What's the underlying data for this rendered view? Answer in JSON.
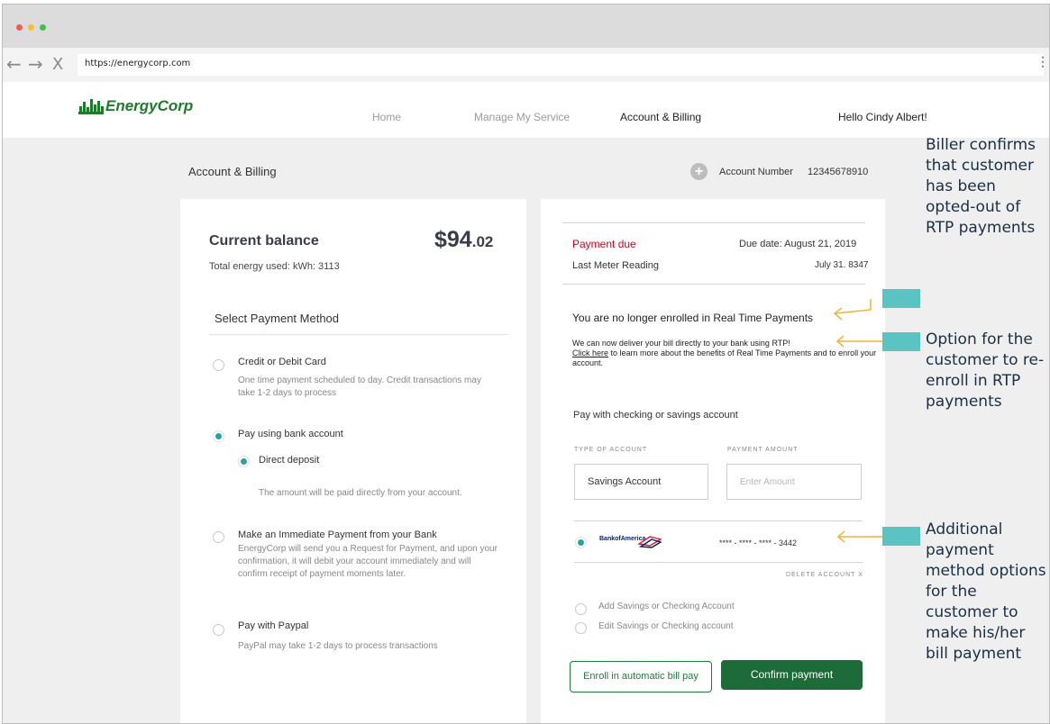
{
  "browser": {
    "url": "https://energycorp.com",
    "back_icon": "←",
    "forward_icon": "→",
    "close_icon": "X",
    "menu_icon": "⋮"
  },
  "header": {
    "logo_text": "EnergyCorp",
    "nav": {
      "home": "Home",
      "manage": "Manage My Service",
      "account": "Account & Billing",
      "greeting": "Hello Cindy Albert!"
    }
  },
  "page": {
    "title": "Account & Billing",
    "add_icon": "+",
    "account_label": "Account Number",
    "account_number": "12345678910"
  },
  "balance": {
    "title": "Current balance",
    "amount_dollars": "$94",
    "amount_cents": ".02",
    "energy": "Total energy used: kWh: 3113"
  },
  "payment_methods": {
    "title": "Select Payment Method",
    "options": [
      {
        "title": "Credit or Debit Card",
        "desc": "One time payment scheduled to day. Credit transactions may take 1-2 days to process",
        "selected": false
      },
      {
        "title": "Pay using bank account",
        "selected": true,
        "sub_title": "Direct deposit",
        "sub_desc": "The amount will be paid directly from your account.",
        "sub_selected": true
      },
      {
        "title": "Make an Immediate Payment from your Bank",
        "desc": "EnergyCorp will send you a Request for Payment, and upon your confirmation, it will debit your account immediately and will confirm receipt of payment moments later.",
        "selected": false
      },
      {
        "title": "Pay with Paypal",
        "desc": "PayPal may take 1-2 days to process transactions",
        "selected": false
      }
    ]
  },
  "payment_due": {
    "label": "Payment due",
    "due_date": "Due date: August 21, 2019",
    "meter_label": "Last Meter Reading",
    "meter_value": "July 31. 8347"
  },
  "rtp": {
    "title": "You are no longer enrolled in Real Time Payments",
    "line1": "We can now deliver your bill directly to your bank using RTP!",
    "link": "Click here",
    "line2": " to learn more about the benefits of Real Time Payments and to enroll your account."
  },
  "pay_form": {
    "title": "Pay with checking or savings account",
    "type_label": "TYPE OF ACCOUNT",
    "type_value": "Savings Account",
    "amount_label": "PAYMENT AMOUNT",
    "amount_placeholder": "Enter Amount",
    "bank_name": "BankofAmerica",
    "masked_account": "**** - **** - **** - 3442",
    "delete_label": "DELETE ACCOUNT X",
    "add_account": "Add Savings or Checking Account",
    "edit_account": "Edit Savings or Checking account",
    "enroll_button": "Enroll in automatic bill pay",
    "confirm_button": "Confirm payment"
  },
  "annotations": {
    "opted_out": "Biller confirms that customer has been opted-out of RTP payments",
    "reenroll": "Option for the customer to re-enroll in RTP payments",
    "additional": "Additional payment method options for the customer to make his/her bill payment"
  },
  "colors": {
    "brand_green": "#1f7a2b",
    "confirm_green": "#1e6b3a",
    "radio_teal": "#26a69a",
    "due_red": "#d0021b",
    "marker_teal": "#5cc3c3",
    "arrow_gold": "#f0b43c"
  }
}
